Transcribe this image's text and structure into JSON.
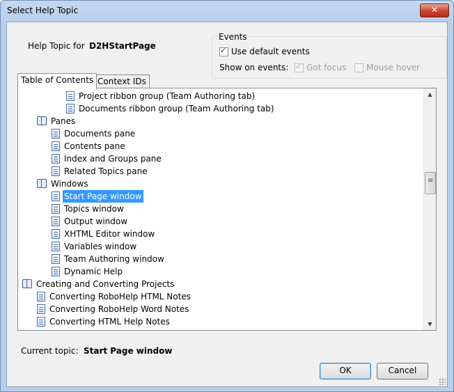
{
  "window": {
    "title": "Select Help Topic",
    "close_glyph": "✕"
  },
  "help_topic": {
    "label": "Help Topic for",
    "name": "D2HStartPage"
  },
  "events": {
    "title": "Events",
    "use_default": {
      "label": "Use default events",
      "checked": true
    },
    "show_on_label": "Show on events:",
    "got_focus": {
      "label": "Got focus",
      "checked": true,
      "enabled": false
    },
    "mouse_hover": {
      "label": "Mouse hover",
      "checked": false,
      "enabled": false
    }
  },
  "tabs": [
    {
      "label": "Table of Contents",
      "active": true
    },
    {
      "label": "Context IDs",
      "active": false
    }
  ],
  "tree": {
    "items": [
      {
        "label": "Project ribbon group (Team Authoring tab)",
        "icon": "page",
        "level": 3
      },
      {
        "label": "Documents ribbon group (Team Authoring tab)",
        "icon": "page",
        "level": 3
      },
      {
        "label": "Panes",
        "icon": "book",
        "level": 1
      },
      {
        "label": "Documents pane",
        "icon": "page",
        "level": 2
      },
      {
        "label": "Contents pane",
        "icon": "page",
        "level": 2
      },
      {
        "label": "Index and Groups pane",
        "icon": "page",
        "level": 2
      },
      {
        "label": "Related Topics pane",
        "icon": "page",
        "level": 2
      },
      {
        "label": "Windows",
        "icon": "book",
        "level": 1
      },
      {
        "label": "Start Page window",
        "icon": "page",
        "level": 2,
        "selected": true
      },
      {
        "label": "Topics window",
        "icon": "page",
        "level": 2
      },
      {
        "label": "Output window",
        "icon": "page",
        "level": 2
      },
      {
        "label": "XHTML Editor window",
        "icon": "page",
        "level": 2
      },
      {
        "label": "Variables window",
        "icon": "page",
        "level": 2
      },
      {
        "label": "Team Authoring window",
        "icon": "page",
        "level": 2
      },
      {
        "label": "Dynamic Help",
        "icon": "page",
        "level": 2
      },
      {
        "label": "Creating and Converting Projects",
        "icon": "book",
        "level": 0
      },
      {
        "label": "Converting RoboHelp HTML Notes",
        "icon": "page",
        "level": 1
      },
      {
        "label": "Converting RoboHelp Word Notes",
        "icon": "page",
        "level": 1
      },
      {
        "label": "Converting HTML Help Notes",
        "icon": "page",
        "level": 1
      }
    ]
  },
  "scrollbar": {
    "up_glyph": "▲",
    "down_glyph": "▼"
  },
  "current_topic": {
    "label": "Current topic:",
    "value": "Start Page window"
  },
  "buttons": {
    "ok": "OK",
    "cancel": "Cancel"
  }
}
